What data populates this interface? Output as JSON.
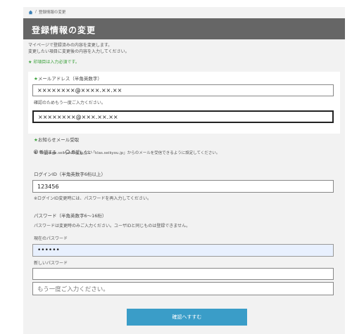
{
  "breadcrumb": {
    "home_icon": "home-icon",
    "separator": "/",
    "current": "登録情報の変更"
  },
  "page": {
    "title": "登録情報の変更"
  },
  "intro": {
    "line1": "マイページで登録済みの内容を変更します。",
    "line2": "変更したい項目に変更後の内容を入力してください。",
    "required_note": "印項目は入力必須です。"
  },
  "email": {
    "label": "メールアドレス（半角英数字）",
    "value": "××××××××@××××.××.××",
    "confirm_note": "確認のためもう一度ご入力ください。",
    "confirm_value": "××××××××@×××.××.××"
  },
  "newsletter": {
    "label": "お知らせメール受取",
    "option_yes": "希望する",
    "option_no": "希望しない",
    "note": "※「mypage.seikyou.ne.jp」と「klas.seikyou.jp」からのメールを受信できるように設定してください。"
  },
  "login": {
    "label": "ログインID（半角英数字6桁以上）",
    "value": "123456",
    "note": "※ログインID変更時には、パスワードを再入力してください。"
  },
  "password": {
    "label": "パスワード（半角英数字6～16桁）",
    "note": "パスワードは変更時のみご入力ください。ユーザIDと同じものは登録できません。",
    "current_label": "現在のパスワード",
    "current_value": "••••••",
    "new_label": "新しいパスワード",
    "new_value": "",
    "confirm_placeholder": "もう一度ご入力ください。"
  },
  "submit": {
    "label": "確認へすすむ"
  },
  "colors": {
    "header": "#666666",
    "button": "#3a9dc8",
    "required": "#3aa03a"
  }
}
